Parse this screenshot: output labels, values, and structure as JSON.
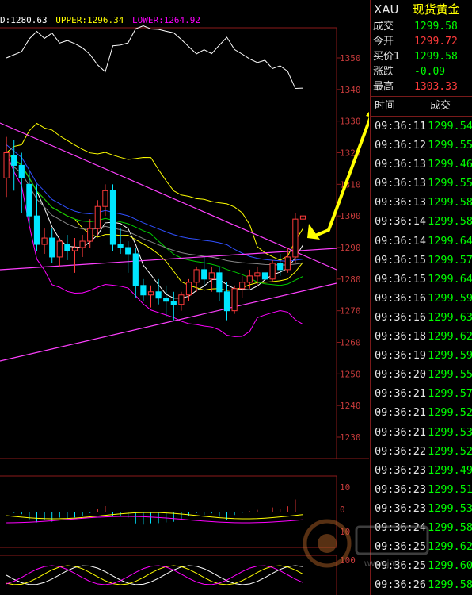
{
  "indicator": {
    "mid": "D:1280.63",
    "upper": "UPPER:1296.34",
    "lower": "LOWER:1264.92",
    "colors": {
      "mid": "#ffffff",
      "upper": "#ffff00",
      "lower": "#ff00ff"
    }
  },
  "price_axis": {
    "labels": [
      "1350",
      "1340",
      "1330",
      "1320",
      "1310",
      "1300",
      "1290",
      "1280",
      "1270",
      "1260",
      "1250",
      "1240",
      "1230"
    ],
    "values": [
      1350,
      1340,
      1330,
      1320,
      1310,
      1300,
      1290,
      1280,
      1270,
      1260,
      1250,
      1240,
      1230
    ]
  },
  "sub_axis_1": {
    "labels": [
      "10",
      "0"
    ],
    "values": [
      10,
      0
    ]
  },
  "sub_axis_2": {
    "labels": [
      "10",
      "100"
    ]
  },
  "quote": {
    "symbol": "XAU",
    "name": "现货黄金",
    "rows": [
      {
        "label": "成交",
        "value": "1299.58",
        "color": "#00ff00"
      },
      {
        "label": "今开",
        "value": "1299.72",
        "color": "#ff3b3b"
      },
      {
        "label": "买价1",
        "value": "1299.58",
        "color": "#00ff00"
      },
      {
        "label": "涨跌",
        "value": "-0.09",
        "color": "#00ff00"
      },
      {
        "label": "最高",
        "value": "1303.33",
        "color": "#ff3b3b"
      }
    ]
  },
  "ticks": {
    "header_time": "时间",
    "header_price": "成交",
    "rows": [
      {
        "time": "09:36:11",
        "price": "1299.54"
      },
      {
        "time": "09:36:12",
        "price": "1299.55"
      },
      {
        "time": "09:36:13",
        "price": "1299.46"
      },
      {
        "time": "09:36:13",
        "price": "1299.55"
      },
      {
        "time": "09:36:13",
        "price": "1299.58"
      },
      {
        "time": "09:36:14",
        "price": "1299.58"
      },
      {
        "time": "09:36:14",
        "price": "1299.64"
      },
      {
        "time": "09:36:15",
        "price": "1299.57"
      },
      {
        "time": "09:36:15",
        "price": "1299.64"
      },
      {
        "time": "09:36:16",
        "price": "1299.59"
      },
      {
        "time": "09:36:16",
        "price": "1299.63"
      },
      {
        "time": "09:36:18",
        "price": "1299.62"
      },
      {
        "time": "09:36:19",
        "price": "1299.59"
      },
      {
        "time": "09:36:20",
        "price": "1299.55"
      },
      {
        "time": "09:36:21",
        "price": "1299.57"
      },
      {
        "time": "09:36:21",
        "price": "1299.52"
      },
      {
        "time": "09:36:21",
        "price": "1299.53"
      },
      {
        "time": "09:36:22",
        "price": "1299.52"
      },
      {
        "time": "09:36:23",
        "price": "1299.49"
      },
      {
        "time": "09:36:23",
        "price": "1299.51"
      },
      {
        "time": "09:36:23",
        "price": "1299.53"
      },
      {
        "time": "09:36:24",
        "price": "1299.58"
      },
      {
        "time": "09:36:25",
        "price": "1299.62"
      },
      {
        "time": "09:36:25",
        "price": "1299.60"
      },
      {
        "time": "09:36:26",
        "price": "1299.58"
      }
    ]
  },
  "candles": [
    {
      "o": 1312,
      "h": 1325,
      "l": 1306,
      "c": 1320
    },
    {
      "o": 1319,
      "h": 1324,
      "l": 1308,
      "c": 1316
    },
    {
      "o": 1316,
      "h": 1320,
      "l": 1301,
      "c": 1312
    },
    {
      "o": 1310,
      "h": 1314,
      "l": 1297,
      "c": 1300
    },
    {
      "o": 1300,
      "h": 1310,
      "l": 1289,
      "c": 1291
    },
    {
      "o": 1291,
      "h": 1296,
      "l": 1288,
      "c": 1293
    },
    {
      "o": 1293,
      "h": 1296,
      "l": 1285,
      "c": 1287
    },
    {
      "o": 1287,
      "h": 1293,
      "l": 1284,
      "c": 1292
    },
    {
      "o": 1291,
      "h": 1294,
      "l": 1286,
      "c": 1289
    },
    {
      "o": 1289,
      "h": 1293,
      "l": 1282,
      "c": 1290
    },
    {
      "o": 1290,
      "h": 1294,
      "l": 1287,
      "c": 1292
    },
    {
      "o": 1292,
      "h": 1299,
      "l": 1290,
      "c": 1296
    },
    {
      "o": 1296,
      "h": 1305,
      "l": 1294,
      "c": 1303
    },
    {
      "o": 1303,
      "h": 1310,
      "l": 1300,
      "c": 1308
    },
    {
      "o": 1308,
      "h": 1310,
      "l": 1289,
      "c": 1291
    },
    {
      "o": 1291,
      "h": 1296,
      "l": 1288,
      "c": 1290
    },
    {
      "o": 1290,
      "h": 1292,
      "l": 1282,
      "c": 1288
    },
    {
      "o": 1288,
      "h": 1290,
      "l": 1274,
      "c": 1278
    },
    {
      "o": 1278,
      "h": 1280,
      "l": 1273,
      "c": 1275
    },
    {
      "o": 1275,
      "h": 1278,
      "l": 1271,
      "c": 1276
    },
    {
      "o": 1276,
      "h": 1280,
      "l": 1272,
      "c": 1274
    },
    {
      "o": 1274,
      "h": 1278,
      "l": 1268,
      "c": 1273
    },
    {
      "o": 1273,
      "h": 1276,
      "l": 1267,
      "c": 1272
    },
    {
      "o": 1272,
      "h": 1276,
      "l": 1270,
      "c": 1275
    },
    {
      "o": 1275,
      "h": 1280,
      "l": 1273,
      "c": 1279
    },
    {
      "o": 1279,
      "h": 1284,
      "l": 1276,
      "c": 1283
    },
    {
      "o": 1283,
      "h": 1287,
      "l": 1278,
      "c": 1280
    },
    {
      "o": 1280,
      "h": 1284,
      "l": 1276,
      "c": 1282
    },
    {
      "o": 1282,
      "h": 1284,
      "l": 1273,
      "c": 1276
    },
    {
      "o": 1276,
      "h": 1279,
      "l": 1267,
      "c": 1270
    },
    {
      "o": 1270,
      "h": 1278,
      "l": 1269,
      "c": 1277
    },
    {
      "o": 1277,
      "h": 1281,
      "l": 1274,
      "c": 1279
    },
    {
      "o": 1279,
      "h": 1283,
      "l": 1277,
      "c": 1281
    },
    {
      "o": 1281,
      "h": 1284,
      "l": 1278,
      "c": 1282
    },
    {
      "o": 1282,
      "h": 1285,
      "l": 1279,
      "c": 1280
    },
    {
      "o": 1280,
      "h": 1286,
      "l": 1279,
      "c": 1285
    },
    {
      "o": 1285,
      "h": 1288,
      "l": 1281,
      "c": 1283
    },
    {
      "o": 1283,
      "h": 1290,
      "l": 1282,
      "c": 1287
    },
    {
      "o": 1287,
      "h": 1301,
      "l": 1285,
      "c": 1299
    },
    {
      "o": 1299,
      "h": 1304,
      "l": 1297,
      "c": 1300
    }
  ],
  "watermark_text": "www.jnd"
}
